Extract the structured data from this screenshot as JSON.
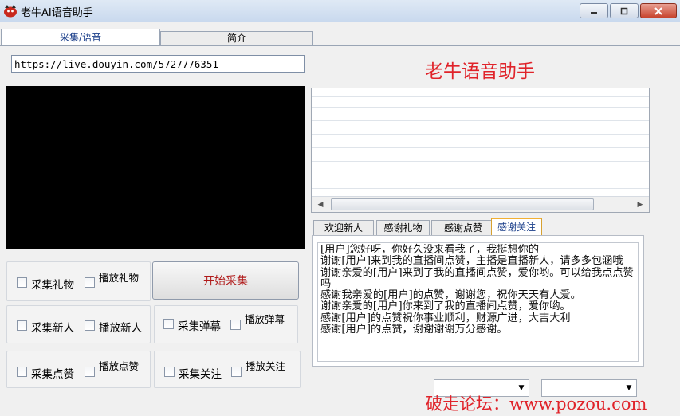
{
  "window": {
    "title": "老牛AI语音助手"
  },
  "tabs": [
    {
      "label": "采集/语音",
      "selected": true
    },
    {
      "label": "简介",
      "selected": false
    }
  ],
  "url_input": {
    "value": "https://live.douyin.com/5727776351"
  },
  "heading": "老牛语音助手",
  "options": {
    "collect_gift": "采集礼物",
    "play_gift": "播放礼物",
    "start_button": "开始采集",
    "collect_new": "采集新人",
    "play_new": "播放新人",
    "collect_danmaku": "采集弹幕",
    "play_danmaku": "播放弹幕",
    "collect_like": "采集点赞",
    "play_like": "播放点赞",
    "collect_follow": "采集关注",
    "play_follow": "播放关注"
  },
  "message_tabs": [
    {
      "label": "欢迎新人",
      "selected": false
    },
    {
      "label": "感谢礼物",
      "selected": false
    },
    {
      "label": "感谢点赞",
      "selected": false
    },
    {
      "label": "感谢关注",
      "selected": true
    }
  ],
  "messages": [
    "[用户]您好呀，你好久没来看我了，我挺想你的",
    "谢谢[用户]来到我的直播间点赞，主播是直播新人，请多多包涵哦",
    "谢谢亲爱的[用户]来到了我的直播间点赞，爱你哟。可以给我点点赞吗",
    "感谢我亲爱的[用户]的点赞，谢谢您，祝你天天有人爱。",
    "谢谢亲爱的[用户]你来到了我的直播间点赞，爱你哟。",
    "感谢[用户]的点赞祝你事业顺利，财源广进，大吉大利",
    "感谢[用户]的点赞，谢谢谢谢万分感谢。"
  ],
  "watermark": "破走论坛：www.pozou.com",
  "colors": {
    "accent_red": "#e0232a",
    "start_text": "#b01a1a",
    "tab_text": "#1a3e8a"
  }
}
